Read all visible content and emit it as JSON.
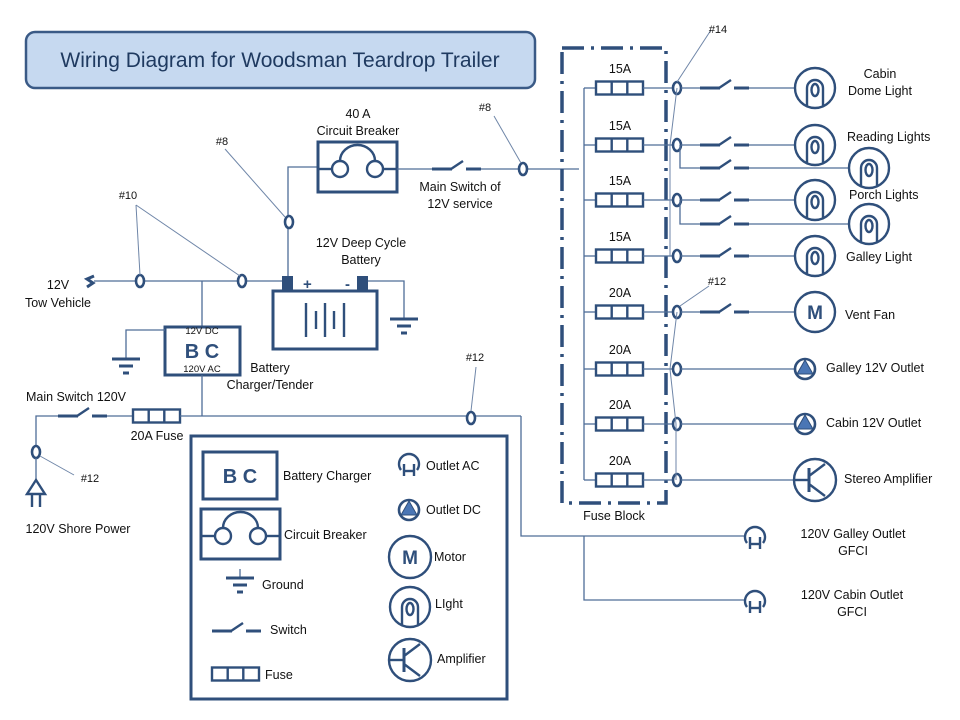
{
  "title": "Wiring Diagram for Woodsman Teardrop Trailer",
  "colors": {
    "symbol": "#2f4f7b",
    "wire": "#4f6d97",
    "title_bg": "#c6d9f0",
    "title_border": "#3a5a86"
  },
  "source": {
    "tow_vehicle": [
      "12V",
      "Tow Vehicle"
    ],
    "shore_power": "120V Shore Power",
    "main_switch_120": "Main Switch 120V",
    "fuse_20a": "20A Fuse"
  },
  "wire_gauges": {
    "tow": "#10",
    "battery": "#8",
    "main": "#8",
    "shore": "#12",
    "ac_feed": "#12",
    "lights": "#14",
    "loads": "#12"
  },
  "breaker": [
    "40 A",
    "Circuit Breaker"
  ],
  "main_switch_12": [
    "Main Switch of",
    "12V service"
  ],
  "battery": {
    "label": [
      "12V Deep Cycle",
      "Battery"
    ],
    "pos": "+",
    "neg": "-"
  },
  "charger": {
    "abbr": "B C",
    "dc": "12V DC",
    "ac": "120V AC",
    "label": [
      "Battery",
      "Charger/Tender"
    ]
  },
  "fuse_block": {
    "label": "Fuse Block",
    "fuses": [
      "15A",
      "15A",
      "15A",
      "15A",
      "20A",
      "20A",
      "20A",
      "20A"
    ]
  },
  "loads": [
    {
      "label": [
        "Cabin",
        "Dome Light"
      ],
      "type": "light"
    },
    {
      "label": [
        "Reading Lights"
      ],
      "type": "light"
    },
    {
      "label": [
        "Porch Lights"
      ],
      "type": "light"
    },
    {
      "label": [
        "Galley Light"
      ],
      "type": "light"
    },
    {
      "label": [
        "Vent Fan"
      ],
      "type": "motor",
      "glyph": "M"
    },
    {
      "label": [
        "Galley 12V Outlet"
      ],
      "type": "outlet-dc"
    },
    {
      "label": [
        "Cabin 12V Outlet"
      ],
      "type": "outlet-dc"
    },
    {
      "label": [
        "Stereo Amplifier"
      ],
      "type": "amplifier"
    }
  ],
  "ac_outlets": [
    {
      "label": [
        "120V  Galley Outlet",
        "GFCI"
      ]
    },
    {
      "label": [
        "120V  Cabin Outlet",
        "GFCI"
      ]
    }
  ],
  "legend": {
    "battery_charger": "Battery Charger",
    "bc_abbr": "B C",
    "circuit_breaker": "Circuit Breaker",
    "ground": "Ground",
    "switch": "Switch",
    "fuse": "Fuse",
    "outlet_ac": "Outlet AC",
    "outlet_dc": "Outlet DC",
    "motor": "Motor",
    "motor_glyph": "M",
    "light": "LIght",
    "amplifier": "Amplifier"
  }
}
